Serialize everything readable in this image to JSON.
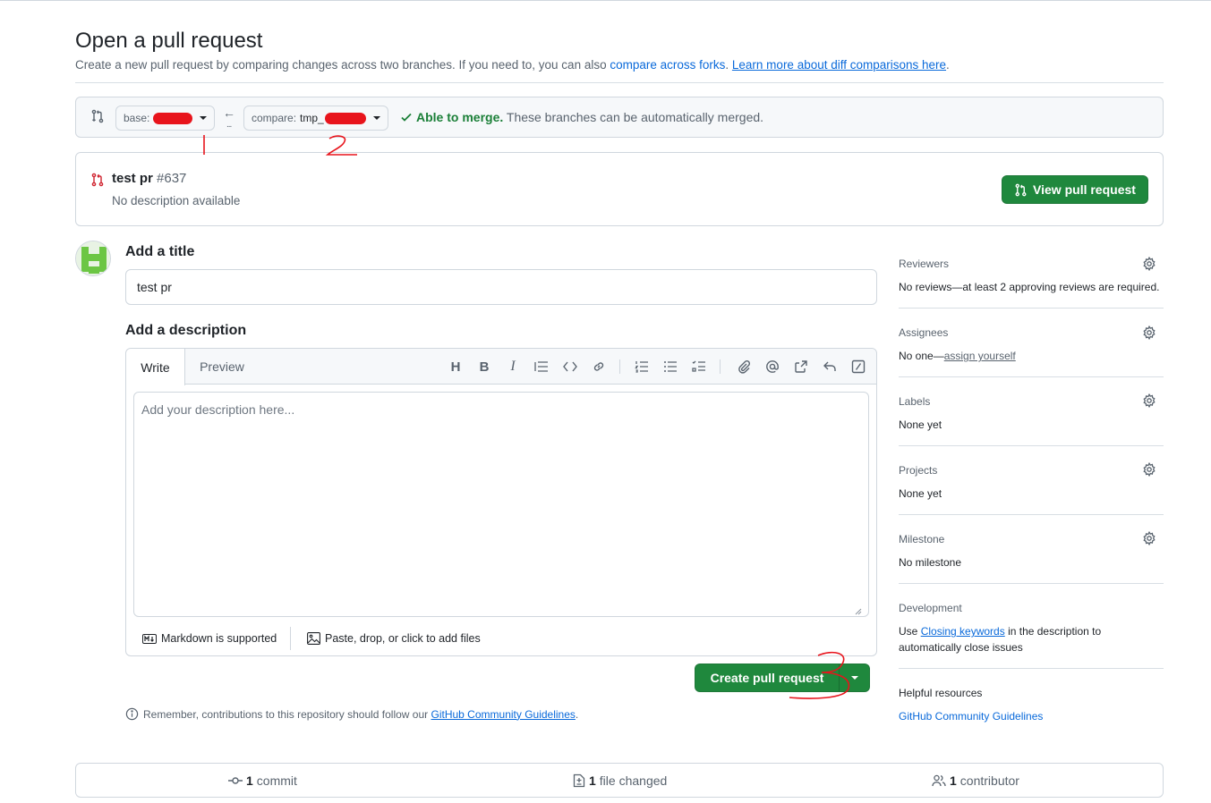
{
  "header": {
    "title": "Open a pull request",
    "subtitle_text": "Create a new pull request by comparing changes across two branches. If you need to, you can also ",
    "compare_forks_link": "compare across forks",
    "learn_more_link": "Learn more about diff comparisons here",
    "subtitle_end": "."
  },
  "range": {
    "base_label": "base:",
    "compare_label": "compare:",
    "compare_value": "tmp_",
    "merge_status": "Able to merge.",
    "merge_detail": " These branches can be automatically merged."
  },
  "existing_pr": {
    "title": "test pr",
    "number": "#637",
    "description": "No description available",
    "view_button": "View pull request"
  },
  "form": {
    "title_heading": "Add a title",
    "title_value": "test pr",
    "description_heading": "Add a description",
    "tabs": {
      "write": "Write",
      "preview": "Preview"
    },
    "description_placeholder": "Add your description here...",
    "markdown_note": "Markdown is supported",
    "attach_note": "Paste, drop, or click to add files",
    "create_button": "Create pull request",
    "remember_text": "Remember, contributions to this repository should follow our ",
    "guidelines_link": "GitHub Community Guidelines",
    "remember_end": "."
  },
  "sidebar": {
    "reviewers": {
      "heading": "Reviewers",
      "value": "No reviews—at least 2 approving reviews are required."
    },
    "assignees": {
      "heading": "Assignees",
      "value_prefix": "No one—",
      "value_link": "assign yourself"
    },
    "labels": {
      "heading": "Labels",
      "value": "None yet"
    },
    "projects": {
      "heading": "Projects",
      "value": "None yet"
    },
    "milestone": {
      "heading": "Milestone",
      "value": "No milestone"
    },
    "development": {
      "heading": "Development",
      "value_prefix": "Use ",
      "value_link": "Closing keywords",
      "value_suffix_1": " in the description to",
      "value_suffix_2": "automatically close issues"
    },
    "helpful": {
      "heading": "Helpful resources",
      "link": "GitHub Community Guidelines"
    }
  },
  "stats": {
    "commits_count": "1",
    "commits_label": " commit",
    "files_count": "1",
    "files_label": " file changed",
    "contributors_count": "1",
    "contributors_label": " contributor"
  },
  "annotations": {
    "mark_1": "1",
    "mark_2": "2",
    "mark_3": "3"
  },
  "colors": {
    "accent": "#0969da",
    "success": "#1f883d",
    "annotation_red": "#e8141c"
  }
}
